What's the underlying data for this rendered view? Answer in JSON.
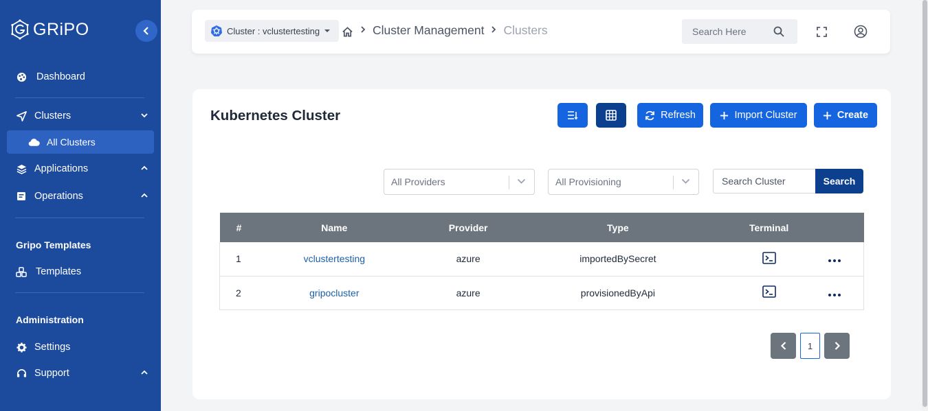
{
  "brand": {
    "name": "GRiPO"
  },
  "sidebar": {
    "items": [
      {
        "label": "Dashboard",
        "icon": "palette-icon"
      },
      {
        "label": "Clusters",
        "icon": "send-icon",
        "expanded": true
      },
      {
        "label": "All Clusters",
        "icon": "cloud-icon",
        "active": true
      },
      {
        "label": "Applications",
        "icon": "layers-icon"
      },
      {
        "label": "Operations",
        "icon": "document-icon"
      }
    ],
    "sections": [
      {
        "title": "Gripo Templates",
        "items": [
          {
            "label": "Templates",
            "icon": "cubes-icon"
          }
        ]
      },
      {
        "title": "Administration",
        "items": [
          {
            "label": "Settings",
            "icon": "gear-icon"
          },
          {
            "label": "Support",
            "icon": "headset-icon"
          }
        ]
      }
    ]
  },
  "header": {
    "cluster_label": "Cluster : vclustertesting",
    "breadcrumb": [
      "Cluster Management",
      "Clusters"
    ],
    "search_placeholder": "Search Here"
  },
  "main": {
    "title": "Kubernetes Cluster",
    "buttons": {
      "refresh": "Refresh",
      "import": "Import Cluster",
      "create": "Create"
    },
    "filters": {
      "providers": "All Providers",
      "provisioning": "All Provisioning"
    },
    "search": {
      "placeholder": "Search Cluster",
      "button": "Search"
    },
    "table": {
      "columns": [
        "#",
        "Name",
        "Provider",
        "Type",
        "Terminal"
      ],
      "rows": [
        {
          "index": "1",
          "name": "vclustertesting",
          "provider": "azure",
          "type": "importedBySecret"
        },
        {
          "index": "2",
          "name": "gripocluster",
          "provider": "azure",
          "type": "provisionedByApi"
        }
      ]
    },
    "pagination": {
      "current": "1"
    }
  },
  "colors": {
    "sidebar": "#1c4a9c",
    "primary": "#1565e0",
    "dark": "#0d3f8f",
    "table_header": "#6c757d"
  }
}
